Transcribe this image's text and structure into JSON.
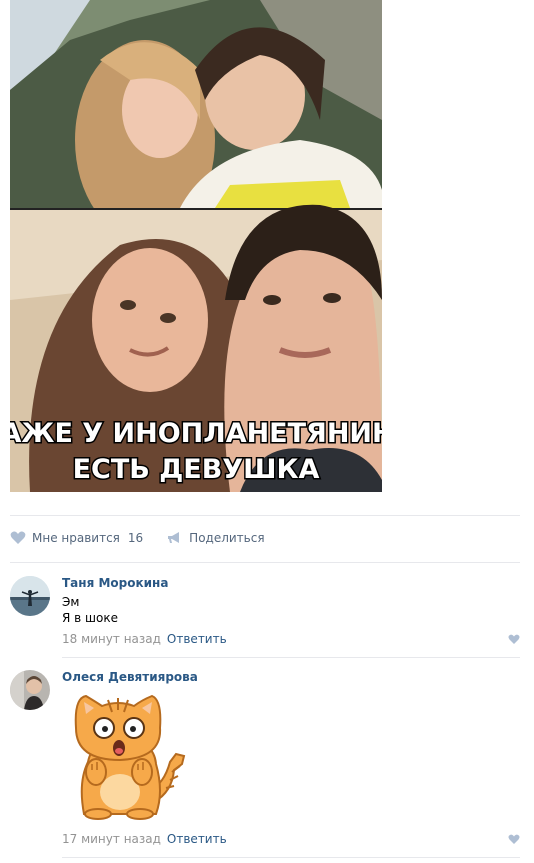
{
  "post": {
    "meme_caption_line1": "ДАЖЕ У ИНОПЛАНЕТЯНИНА",
    "meme_caption_line2": "ЕСТЬ ДЕВУШКА",
    "like_label": "Мне нравится",
    "like_count": "16",
    "share_label": "Поделиться"
  },
  "comments": [
    {
      "author": "Таня Морокина",
      "lines": [
        "Эм",
        "Я в шоке"
      ],
      "time": "18 минут назад",
      "reply_label": "Ответить"
    },
    {
      "author": "Олеся Девятиярова",
      "time": "17 минут назад",
      "reply_label": "Ответить"
    }
  ],
  "colors": {
    "link": "#2a5885",
    "muted": "#939393",
    "icon": "#aebed3",
    "divider": "#e7e8ec"
  }
}
